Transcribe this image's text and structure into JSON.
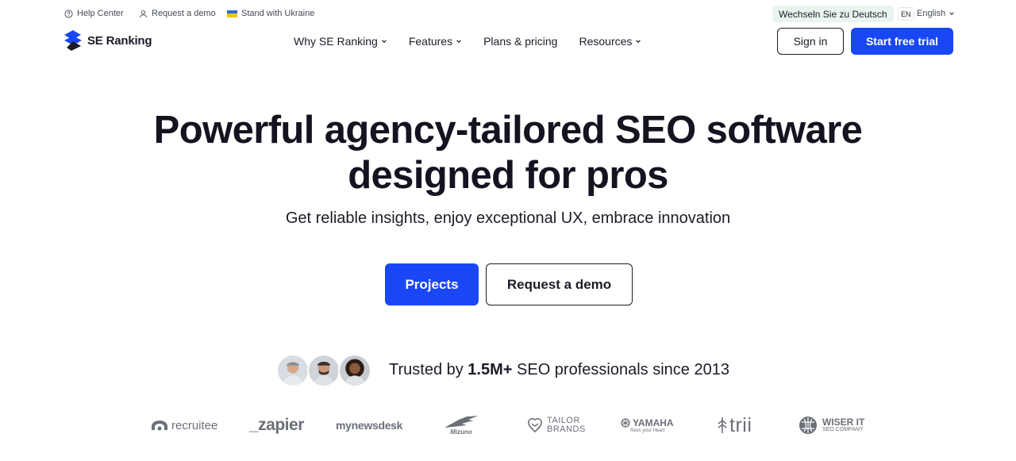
{
  "topbar": {
    "help_center": "Help Center",
    "request_demo": "Request a demo",
    "stand_ukraine": "Stand with Ukraine",
    "lang_switch": "Wechseln Sie zu Deutsch",
    "lang_code": "EN",
    "lang_name": "English"
  },
  "nav": {
    "logo": "SE Ranking",
    "items": [
      {
        "label": "Why SE Ranking",
        "has_dropdown": true
      },
      {
        "label": "Features",
        "has_dropdown": true
      },
      {
        "label": "Plans & pricing",
        "has_dropdown": false
      },
      {
        "label": "Resources",
        "has_dropdown": true
      }
    ],
    "sign_in": "Sign in",
    "start_trial": "Start free trial"
  },
  "hero": {
    "title_line1": "Powerful agency-tailored SEO software",
    "title_line2": "designed for pros",
    "subtitle": "Get reliable insights, enjoy exceptional UX, embrace innovation",
    "primary_button": "Projects",
    "secondary_button": "Request a demo"
  },
  "trust": {
    "prefix": "Trusted by ",
    "count": "1.5M+",
    "suffix": " SEO professionals since 2013"
  },
  "brands": {
    "recruitee": "recruitee",
    "zapier": "_zapier",
    "mynewsdesk": "mynewsdesk",
    "mizuno": "Mizuno",
    "tailor_line1": "TAILOR",
    "tailor_line2": "BRANDS",
    "yamaha": "YAMAHA",
    "yamaha_tagline": "Revs your Heart",
    "trii": "trii",
    "wiser_line1": "WISER IT",
    "wiser_line2": "SEO COMPANY"
  },
  "colors": {
    "accent": "#1947f5",
    "text": "#1c1c28",
    "lang_switch_bg": "#e9f4ef",
    "brand_gray": "#6b6f78"
  }
}
